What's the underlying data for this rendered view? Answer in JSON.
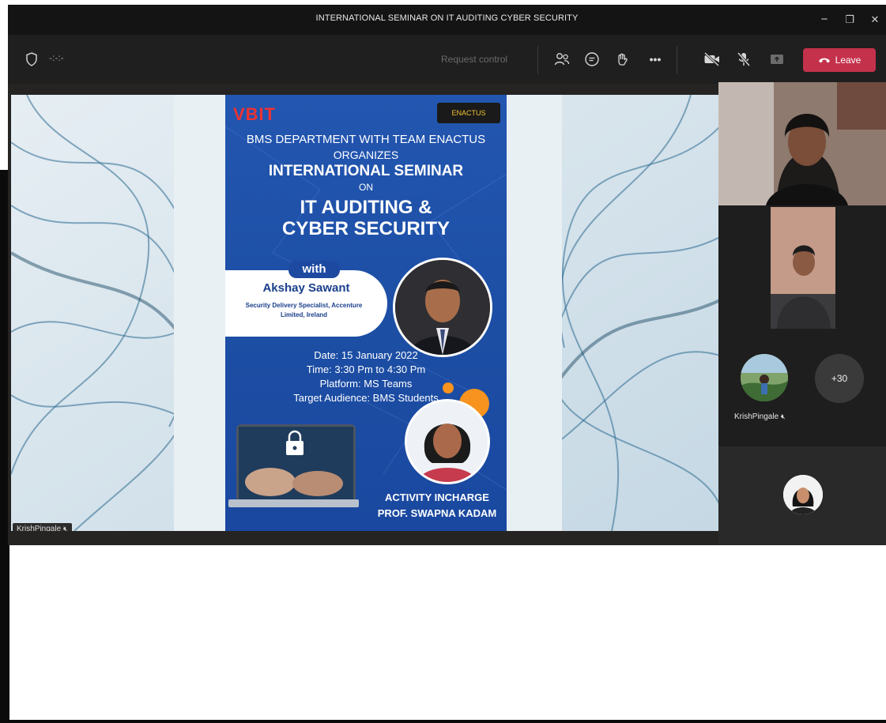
{
  "window": {
    "title": "INTERNATIONAL SEMINAR ON IT AUDITING CYBER SECURITY",
    "minimize": "−",
    "maximize": "❐",
    "close": "✕"
  },
  "toolbar": {
    "timer": "-:-:-",
    "request_control": "Request control",
    "leave_label": "Leave"
  },
  "poster": {
    "logo_text": "VBIT",
    "enactus_label": "ENACTUS",
    "line1": "BMS DEPARTMENT WITH TEAM ENACTUS",
    "line2": "ORGANIZES",
    "line3": "INTERNATIONAL SEMINAR",
    "line4": "ON",
    "line5": "IT AUDITING &",
    "line6": "CYBER SECURITY",
    "with": "with",
    "guest_name": "Akshay Sawant",
    "guest_role": "Security Delivery Specialist, Accenture",
    "guest_org": "Limited, Ireland",
    "date": "Date: 15 January 2022",
    "time": "Time: 3:30 Pm to 4:30 Pm",
    "platform": "Platform: MS Teams",
    "audience": "Target Audience: BMS Students",
    "incharge_label": "ACTIVITY INCHARGE",
    "incharge_name": "PROF. SWAPNA KADAM"
  },
  "stage": {
    "presenter_name": "KrishPingale"
  },
  "gallery": {
    "participant_name": "KrishPingale",
    "overflow_count": "+30"
  },
  "colors": {
    "leave": "#c4314b",
    "poster_blue": "#1c4ea4",
    "accent_orange": "#f7931e"
  }
}
